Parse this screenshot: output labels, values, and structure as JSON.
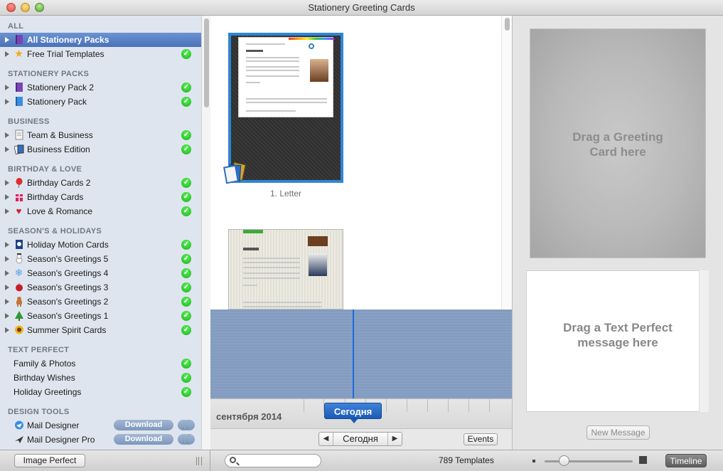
{
  "window": {
    "title": "Stationery Greeting Cards"
  },
  "sidebar": {
    "sections": [
      {
        "label": "ALL"
      },
      {
        "label": "STATIONERY PACKS"
      },
      {
        "label": "BUSINESS"
      },
      {
        "label": "BIRTHDAY & LOVE"
      },
      {
        "label": "SEASON'S & HOLIDAYS"
      },
      {
        "label": "TEXT PERFECT"
      },
      {
        "label": "DESIGN TOOLS"
      }
    ],
    "items": [
      {
        "label": "All Stationery Packs",
        "icon": "purple-book-icon",
        "installed": false,
        "selected": true
      },
      {
        "label": "Free Trial Templates",
        "icon": "star-icon",
        "installed": true
      },
      {
        "label": "Stationery Pack 2",
        "icon": "purple-book-icon",
        "installed": true
      },
      {
        "label": "Stationery Pack",
        "icon": "blue-book-icon",
        "installed": true
      },
      {
        "label": "Team & Business",
        "icon": "document-icon",
        "installed": true
      },
      {
        "label": "Business Edition",
        "icon": "cards-icon",
        "installed": true
      },
      {
        "label": "Birthday Cards 2",
        "icon": "balloon-icon",
        "installed": true
      },
      {
        "label": "Birthday Cards",
        "icon": "gift-icon",
        "installed": true
      },
      {
        "label": "Love & Romance",
        "icon": "heart-icon",
        "installed": true
      },
      {
        "label": "Holiday Motion Cards",
        "icon": "motion-icon",
        "installed": true
      },
      {
        "label": "Season's Greetings 5",
        "icon": "snowman-icon",
        "installed": true
      },
      {
        "label": "Season's Greetings 4",
        "icon": "snowflake-icon",
        "installed": true
      },
      {
        "label": "Season's Greetings 3",
        "icon": "ornament-icon",
        "installed": true
      },
      {
        "label": "Season's Greetings 2",
        "icon": "gingerbread-icon",
        "installed": true
      },
      {
        "label": "Season's Greetings 1",
        "icon": "tree-icon",
        "installed": true
      },
      {
        "label": "Summer Spirit Cards",
        "icon": "sunflower-icon",
        "installed": true
      },
      {
        "label": "Family & Photos",
        "installed": true
      },
      {
        "label": "Birthday Wishes",
        "installed": true
      },
      {
        "label": "Holiday Greetings",
        "installed": true
      },
      {
        "label": "Mail Designer",
        "icon": "mail-designer-icon",
        "download": "Download"
      },
      {
        "label": "Mail Designer Pro",
        "icon": "mail-designer-pro-icon",
        "download": "Download"
      }
    ]
  },
  "gallery": {
    "captions": [
      "1. Letter"
    ]
  },
  "timeline": {
    "month": "сентября 2014",
    "today_tag": "Сегодня",
    "nav_today": "Сегодня",
    "events": "Events"
  },
  "right": {
    "drop_card": [
      "Drag a Greeting",
      "Card here"
    ],
    "drop_message": [
      "Drag a Text Perfect",
      "message here"
    ],
    "new_message": "New Message"
  },
  "bottom": {
    "image_perfect": "Image Perfect",
    "search_placeholder": "",
    "template_count": "789 Templates",
    "timeline": "Timeline",
    "zoom_level": 0.22
  },
  "colors": {
    "selection": "#4a72ba",
    "accent_blue": "#2f86d6",
    "check_green": "#17b417",
    "timeline_bg": "#87a0c4"
  }
}
